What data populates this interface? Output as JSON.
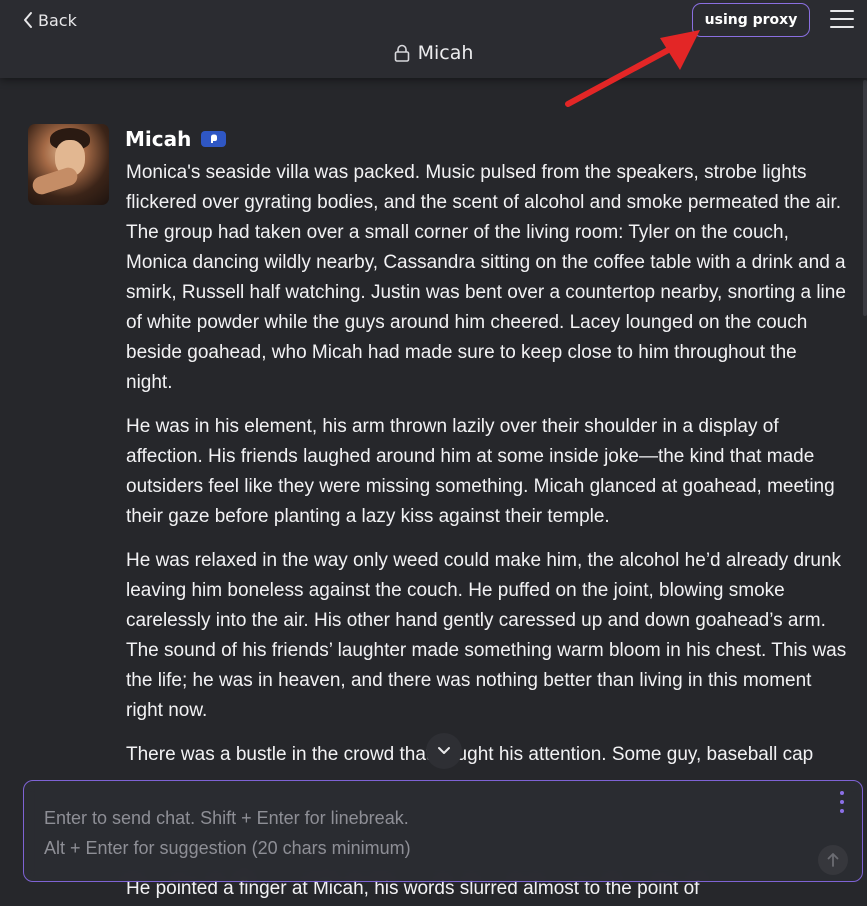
{
  "header": {
    "back_label": "Back",
    "proxy_label": "using proxy",
    "title": "Micah",
    "accent_color": "#8a6fe0"
  },
  "message": {
    "author": "Micah",
    "paragraphs": [
      "Monica's seaside villa was packed. Music pulsed from the speakers, strobe lights flickered over gyrating bodies, and the scent of alcohol and smoke permeated the air. The group had taken over a small corner of the living room: Tyler on the couch, Monica dancing wildly nearby, Cassandra sitting on the coffee table with a drink and a smirk, Russell half watching. Justin was bent over a countertop nearby, snorting a line of white powder while the guys around him cheered. Lacey lounged on the couch beside goahead, who Micah had made sure to keep close to him throughout the night.",
      "He was in his element, his arm thrown lazily over their shoulder in a display of affection. His friends laughed around him at some inside joke—the kind that made outsiders feel like they were missing something. Micah glanced at goahead, meeting their gaze before planting a lazy kiss against their temple.",
      "He was relaxed in the way only weed could make him, the alcohol he’d already drunk leaving him boneless against the couch. He puffed on the joint, blowing smoke carelessly into the air. His other hand gently caressed up and down goahead’s arm. The sound of his friends’ laughter made something warm bloom in his chest. This was the life; he was in heaven, and there was nothing better than living in this moment right now.",
      "There was a bustle in the crowd that caught his attention. Some guy, baseball cap",
      "He pointed a finger at Micah, his words slurred almost to the point of"
    ]
  },
  "chat_input": {
    "placeholder": "Enter to send chat. Shift + Enter for linebreak.\nAlt + Enter for suggestion (20 chars minimum)"
  },
  "icons": {
    "back": "chevron-left-icon",
    "menu": "hamburger-icon",
    "title_lock": "lock-icon",
    "scroll_down": "chevron-down-icon",
    "options": "vertical-dots-icon",
    "send": "arrow-up-icon"
  }
}
